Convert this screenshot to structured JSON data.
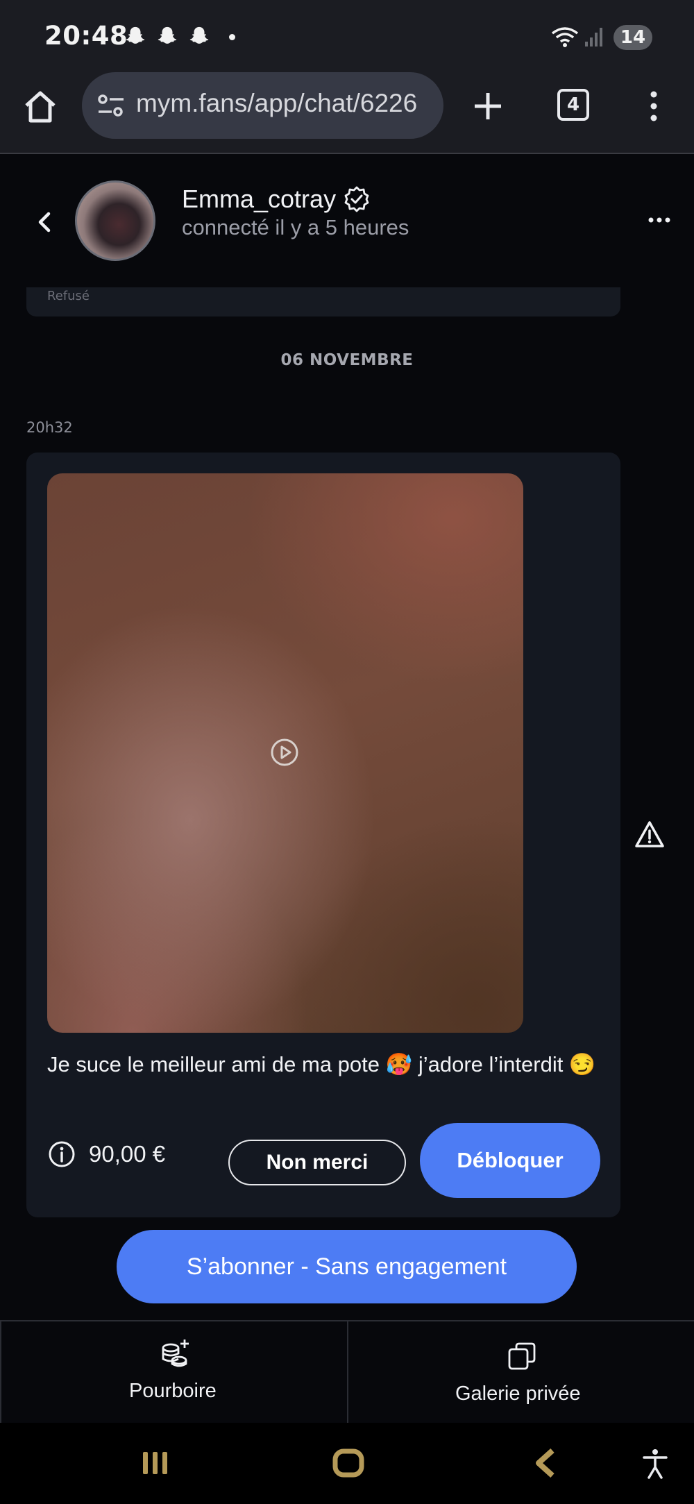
{
  "status_bar": {
    "time": "20:48",
    "notification_icons": [
      "snapchat-icon",
      "snapchat-icon",
      "snapchat-icon"
    ],
    "battery": "14"
  },
  "browser": {
    "url": "mym.fans/app/chat/6226",
    "tab_count": "4"
  },
  "chat_header": {
    "name": "Emma_cotray",
    "presence": "connecté il y a 5 heures"
  },
  "conversation": {
    "previous_card_text": "Refusé",
    "date_separator": "06 NOVEMBRE",
    "message": {
      "time": "20h32",
      "text": "Je suce le meilleur ami de ma pote 🥵 j’adore l’interdit 😏",
      "price": "90,00 €",
      "decline_label": "Non merci",
      "unlock_label": "Débloquer"
    }
  },
  "subscribe_label": "S’abonner - Sans engagement",
  "action_bar": {
    "tip_label": "Pourboire",
    "gallery_label": "Galerie privée"
  },
  "colors": {
    "accent": "#4d7cf4",
    "background": "#07080c",
    "card": "#141821"
  }
}
